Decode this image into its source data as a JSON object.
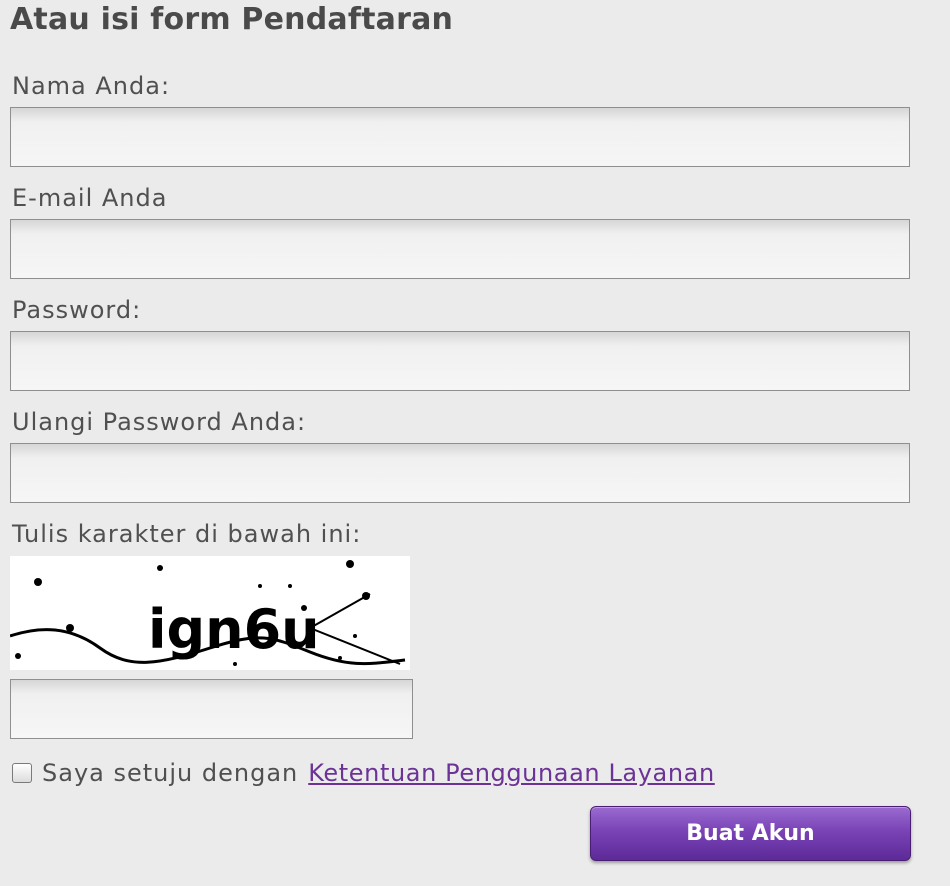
{
  "form": {
    "title": "Atau isi form Pendaftaran",
    "name_label": "Nama Anda:",
    "name_value": "",
    "email_label": "E-mail Anda",
    "email_value": "",
    "password_label": "Password:",
    "password_value": "",
    "password_repeat_label": "Ulangi Password Anda:",
    "password_repeat_value": "",
    "captcha_label": "Tulis karakter di bawah ini:",
    "captcha_text": "ign6u",
    "captcha_value": "",
    "agree_checked": false,
    "agree_text": "Saya setuju dengan",
    "terms_link": "Ketentuan Penggunaan Layanan",
    "submit_label": "Buat Akun"
  }
}
